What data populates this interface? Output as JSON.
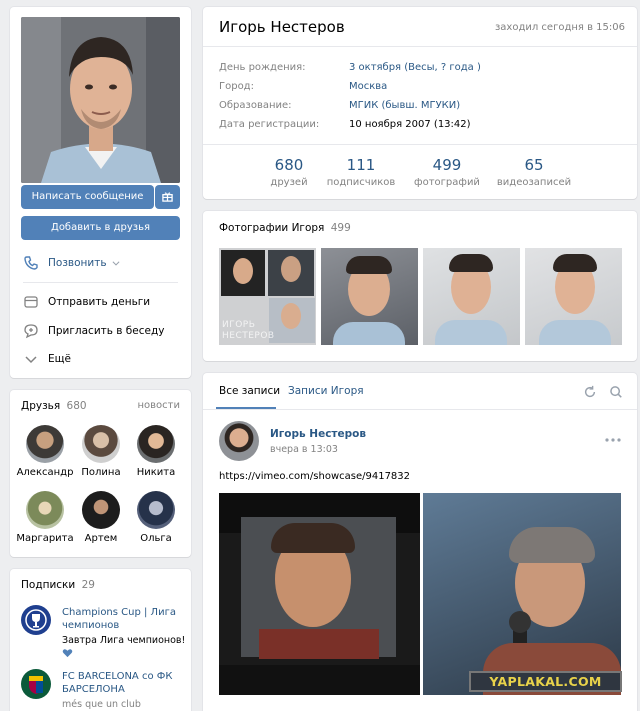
{
  "profile": {
    "name": "Игорь Нестеров",
    "last_seen": "заходил сегодня в 15:06",
    "fields": [
      {
        "label": "День рождения:",
        "value": "3 октября (Весы, ? года )"
      },
      {
        "label": "Город:",
        "value": "Москва"
      },
      {
        "label": "Образование:",
        "value": "МГИК (бывш. МГУКИ)"
      },
      {
        "label": "Дата регистрации:",
        "value": "10 ноября 2007 (13:42)"
      }
    ],
    "counters": [
      {
        "value": "680",
        "label": "друзей"
      },
      {
        "value": "111",
        "label": "подписчиков"
      },
      {
        "value": "499",
        "label": "фотографий"
      },
      {
        "value": "65",
        "label": "видеозаписей"
      }
    ]
  },
  "actions": {
    "message_label": "Написать сообщение",
    "add_friend_label": "Добавить в друзья",
    "call_label": "Позвонить",
    "send_money_label": "Отправить деньги",
    "invite_label": "Пригласить в беседу",
    "more_label": "Ещё"
  },
  "friends": {
    "title": "Друзья",
    "count": "680",
    "news_link": "новости",
    "items": [
      {
        "name": "Александр"
      },
      {
        "name": "Полина"
      },
      {
        "name": "Никита"
      },
      {
        "name": "Маргарита"
      },
      {
        "name": "Артем"
      },
      {
        "name": "Ольга"
      }
    ]
  },
  "subscriptions": {
    "title": "Подписки",
    "count": "29",
    "items": [
      {
        "name": "Champions Cup | Лига чемпионов",
        "status": "Завтра Лига чемпионов!"
      },
      {
        "name": "FC BARCELONA со ФК БАРСЕЛОНА",
        "status": "més que un club"
      }
    ]
  },
  "photos": {
    "title": "Фотографии Игоря",
    "count": "499",
    "overlay_text": "ИГОРЬ НЕСТЕРОВ"
  },
  "wall": {
    "tabs": [
      "Все записи",
      "Записи Игоря"
    ],
    "post": {
      "author": "Игорь Нестеров",
      "time": "вчера в 13:03",
      "text": "https://vimeo.com/showcase/9417832"
    }
  },
  "watermark": "YAPLAKAL.COM",
  "colors": {
    "accent": "#5181b8",
    "link": "#2a5885",
    "muted": "#828282",
    "page_bg": "#edeef0"
  }
}
